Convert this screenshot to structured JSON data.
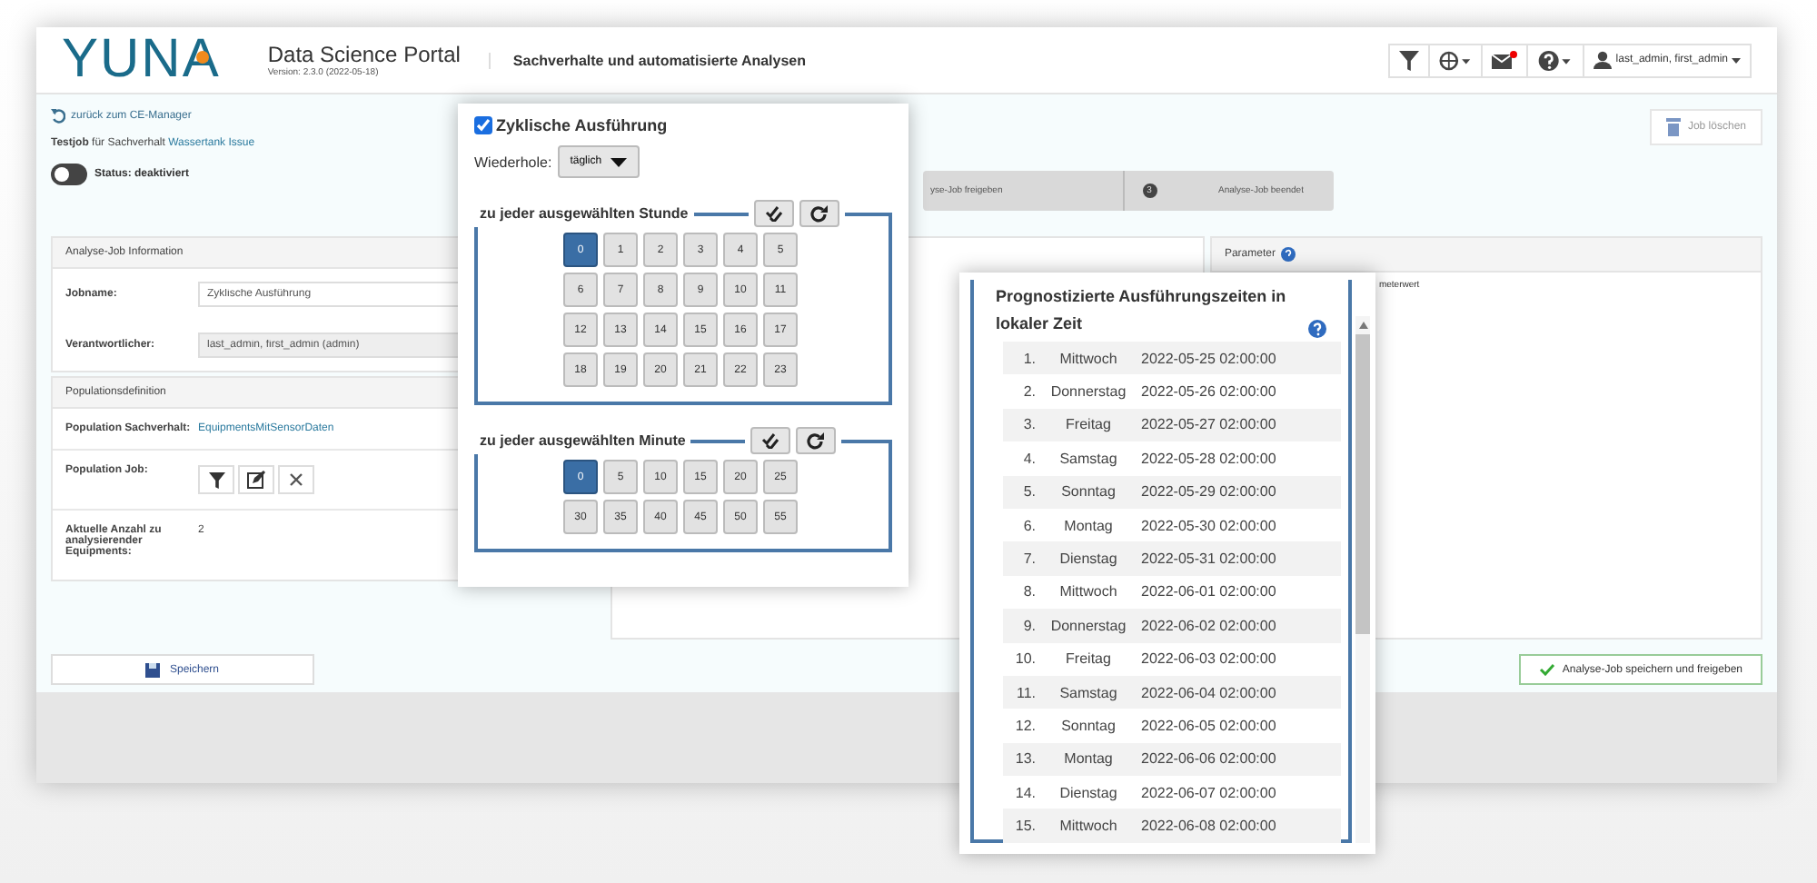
{
  "header": {
    "logo": "YUNA",
    "app_name": "Data Science Portal",
    "version": "Version: 2.3.0 (2022-05-18)",
    "page_title": "Sachverhalte und automatisierte Analysen",
    "user": "last_admin, first_admin",
    "mail_unread": true
  },
  "top": {
    "back_link": "zurück zum CE-Manager",
    "testjob_prefix": "Testjob",
    "testjob_mid": "für Sachverhalt",
    "testjob_link": "Wassertank Issue",
    "status": {
      "label": "Status: deaktiviert",
      "on": false
    },
    "delete_button": "Job löschen"
  },
  "stepper": [
    {
      "label": "yse-Job freigeben"
    },
    {
      "label": "Analyse-Job beendet",
      "number": "3"
    }
  ],
  "info_panel": {
    "title": "Analyse-Job Information",
    "fields": [
      {
        "label": "Jobname:",
        "value": "Zyklische Ausführung",
        "disabled": false
      },
      {
        "label": "Verantwortlicher:",
        "value": "last_admin, first_admin (admin)",
        "disabled": true
      }
    ]
  },
  "population_panel": {
    "title": "Populationsdefinition",
    "sachverhalt_label": "Population Sachverhalt:",
    "sachverhalt_link": "EquipmentsMitSensorDaten",
    "job_label": "Population Job:",
    "count_label": "Aktuelle Anzahl zu analysierender Equipments:",
    "count": "2"
  },
  "parameter_panel": {
    "title": "Parameter",
    "column": "meterwert"
  },
  "footer": {
    "save_button": "Speichern",
    "save_release_button": "Analyse-Job speichern und freigeben"
  },
  "schedule_popup": {
    "cyclic": {
      "label": "Zyklische Ausführung",
      "checked": true
    },
    "repeat_label": "Wiederhole:",
    "repeat_value": "täglich",
    "hour_legend": "zu jeder ausgewählten Stunde",
    "hours": [
      {
        "label": "0",
        "selected": true
      },
      {
        "label": "1",
        "selected": false
      },
      {
        "label": "2",
        "selected": false
      },
      {
        "label": "3",
        "selected": false
      },
      {
        "label": "4",
        "selected": false
      },
      {
        "label": "5",
        "selected": false
      },
      {
        "label": "6",
        "selected": false
      },
      {
        "label": "7",
        "selected": false
      },
      {
        "label": "8",
        "selected": false
      },
      {
        "label": "9",
        "selected": false
      },
      {
        "label": "10",
        "selected": false
      },
      {
        "label": "11",
        "selected": false
      },
      {
        "label": "12",
        "selected": false
      },
      {
        "label": "13",
        "selected": false
      },
      {
        "label": "14",
        "selected": false
      },
      {
        "label": "15",
        "selected": false
      },
      {
        "label": "16",
        "selected": false
      },
      {
        "label": "17",
        "selected": false
      },
      {
        "label": "18",
        "selected": false
      },
      {
        "label": "19",
        "selected": false
      },
      {
        "label": "20",
        "selected": false
      },
      {
        "label": "21",
        "selected": false
      },
      {
        "label": "22",
        "selected": false
      },
      {
        "label": "23",
        "selected": false
      }
    ],
    "minute_legend": "zu jeder ausgewählten Minute",
    "minutes": [
      {
        "label": "0",
        "selected": true
      },
      {
        "label": "5",
        "selected": false
      },
      {
        "label": "10",
        "selected": false
      },
      {
        "label": "15",
        "selected": false
      },
      {
        "label": "20",
        "selected": false
      },
      {
        "label": "25",
        "selected": false
      },
      {
        "label": "30",
        "selected": false
      },
      {
        "label": "35",
        "selected": false
      },
      {
        "label": "40",
        "selected": false
      },
      {
        "label": "45",
        "selected": false
      },
      {
        "label": "50",
        "selected": false
      },
      {
        "label": "55",
        "selected": false
      }
    ]
  },
  "forecast_popup": {
    "title": "Prognostizierte Ausführungszeiten in lokaler Zeit",
    "rows": [
      {
        "index": "1.",
        "day": "Mittwoch",
        "time": "2022-05-25 02:00:00"
      },
      {
        "index": "2.",
        "day": "Donnerstag",
        "time": "2022-05-26 02:00:00"
      },
      {
        "index": "3.",
        "day": "Freitag",
        "time": "2022-05-27 02:00:00"
      },
      {
        "index": "4.",
        "day": "Samstag",
        "time": "2022-05-28 02:00:00"
      },
      {
        "index": "5.",
        "day": "Sonntag",
        "time": "2022-05-29 02:00:00"
      },
      {
        "index": "6.",
        "day": "Montag",
        "time": "2022-05-30 02:00:00"
      },
      {
        "index": "7.",
        "day": "Dienstag",
        "time": "2022-05-31 02:00:00"
      },
      {
        "index": "8.",
        "day": "Mittwoch",
        "time": "2022-06-01 02:00:00"
      },
      {
        "index": "9.",
        "day": "Donnerstag",
        "time": "2022-06-02 02:00:00"
      },
      {
        "index": "10.",
        "day": "Freitag",
        "time": "2022-06-03 02:00:00"
      },
      {
        "index": "11.",
        "day": "Samstag",
        "time": "2022-06-04 02:00:00"
      },
      {
        "index": "12.",
        "day": "Sonntag",
        "time": "2022-06-05 02:00:00"
      },
      {
        "index": "13.",
        "day": "Montag",
        "time": "2022-06-06 02:00:00"
      },
      {
        "index": "14.",
        "day": "Dienstag",
        "time": "2022-06-07 02:00:00"
      },
      {
        "index": "15.",
        "day": "Mittwoch",
        "time": "2022-06-08 02:00:00"
      }
    ]
  }
}
